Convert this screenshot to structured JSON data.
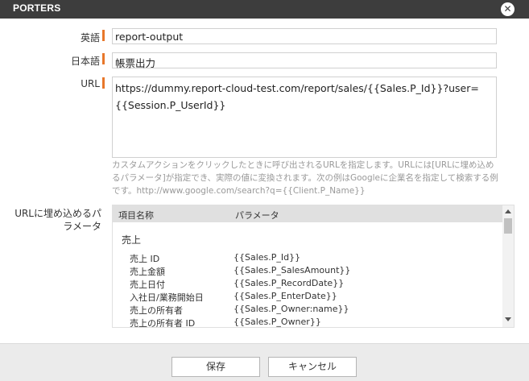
{
  "window": {
    "title": "PORTERS",
    "close_label": "✕"
  },
  "form": {
    "english": {
      "label": "英語",
      "value": "report-output"
    },
    "japanese": {
      "label": "日本語",
      "value": "帳票出力"
    },
    "url": {
      "label": "URL",
      "value": "https://dummy.report-cloud-test.com/report/sales/{{Sales.P_Id}}?user={{Session.P_UserId}}",
      "hint": "カスタムアクションをクリックしたときに呼び出されるURLを指定します。URLには[URLに埋め込めるパラメータ]が指定でき、実際の値に変換されます。次の例はGoogleに企業名を指定して検索する例です。http://www.google.com/search?q={{Client.P_Name}}"
    }
  },
  "params": {
    "label": "URLに埋め込めるパラメータ",
    "header": {
      "name": "項目名称",
      "param": "パラメータ"
    },
    "group_title": "売上",
    "rows": [
      {
        "name": "売上 ID",
        "param": "{{Sales.P_Id}}"
      },
      {
        "name": "売上金額",
        "param": "{{Sales.P_SalesAmount}}"
      },
      {
        "name": "売上日付",
        "param": "{{Sales.P_RecordDate}}"
      },
      {
        "name": "入社日/業務開始日",
        "param": "{{Sales.P_EnterDate}}"
      },
      {
        "name": "売上の所有者",
        "param": "{{Sales.P_Owner:name}}"
      },
      {
        "name": "売上の所有者 ID",
        "param": "{{Sales.P_Owner}}"
      }
    ]
  },
  "footer": {
    "save_label": "保存",
    "cancel_label": "キャンセル"
  },
  "colors": {
    "titlebar": "#3d3d3d",
    "required_mark": "#e8772a",
    "footer_bg": "#ebebeb"
  }
}
